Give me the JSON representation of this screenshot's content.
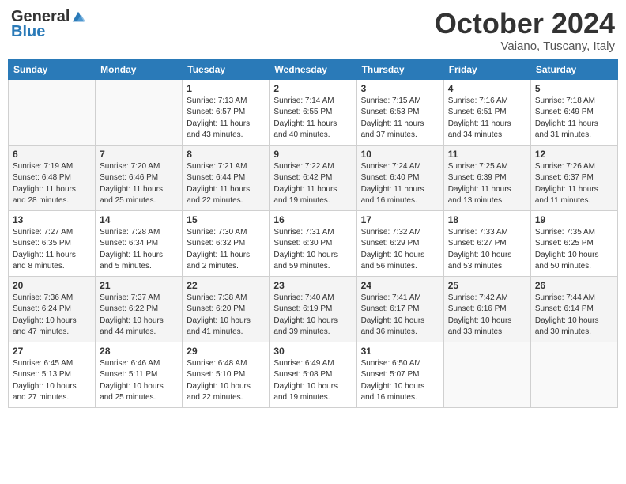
{
  "header": {
    "logo_general": "General",
    "logo_blue": "Blue",
    "month_title": "October 2024",
    "location": "Vaiano, Tuscany, Italy"
  },
  "days_of_week": [
    "Sunday",
    "Monday",
    "Tuesday",
    "Wednesday",
    "Thursday",
    "Friday",
    "Saturday"
  ],
  "weeks": [
    [
      {
        "day": "",
        "sunrise": "",
        "sunset": "",
        "daylight": ""
      },
      {
        "day": "",
        "sunrise": "",
        "sunset": "",
        "daylight": ""
      },
      {
        "day": "1",
        "sunrise": "Sunrise: 7:13 AM",
        "sunset": "Sunset: 6:57 PM",
        "daylight": "Daylight: 11 hours and 43 minutes."
      },
      {
        "day": "2",
        "sunrise": "Sunrise: 7:14 AM",
        "sunset": "Sunset: 6:55 PM",
        "daylight": "Daylight: 11 hours and 40 minutes."
      },
      {
        "day": "3",
        "sunrise": "Sunrise: 7:15 AM",
        "sunset": "Sunset: 6:53 PM",
        "daylight": "Daylight: 11 hours and 37 minutes."
      },
      {
        "day": "4",
        "sunrise": "Sunrise: 7:16 AM",
        "sunset": "Sunset: 6:51 PM",
        "daylight": "Daylight: 11 hours and 34 minutes."
      },
      {
        "day": "5",
        "sunrise": "Sunrise: 7:18 AM",
        "sunset": "Sunset: 6:49 PM",
        "daylight": "Daylight: 11 hours and 31 minutes."
      }
    ],
    [
      {
        "day": "6",
        "sunrise": "Sunrise: 7:19 AM",
        "sunset": "Sunset: 6:48 PM",
        "daylight": "Daylight: 11 hours and 28 minutes."
      },
      {
        "day": "7",
        "sunrise": "Sunrise: 7:20 AM",
        "sunset": "Sunset: 6:46 PM",
        "daylight": "Daylight: 11 hours and 25 minutes."
      },
      {
        "day": "8",
        "sunrise": "Sunrise: 7:21 AM",
        "sunset": "Sunset: 6:44 PM",
        "daylight": "Daylight: 11 hours and 22 minutes."
      },
      {
        "day": "9",
        "sunrise": "Sunrise: 7:22 AM",
        "sunset": "Sunset: 6:42 PM",
        "daylight": "Daylight: 11 hours and 19 minutes."
      },
      {
        "day": "10",
        "sunrise": "Sunrise: 7:24 AM",
        "sunset": "Sunset: 6:40 PM",
        "daylight": "Daylight: 11 hours and 16 minutes."
      },
      {
        "day": "11",
        "sunrise": "Sunrise: 7:25 AM",
        "sunset": "Sunset: 6:39 PM",
        "daylight": "Daylight: 11 hours and 13 minutes."
      },
      {
        "day": "12",
        "sunrise": "Sunrise: 7:26 AM",
        "sunset": "Sunset: 6:37 PM",
        "daylight": "Daylight: 11 hours and 11 minutes."
      }
    ],
    [
      {
        "day": "13",
        "sunrise": "Sunrise: 7:27 AM",
        "sunset": "Sunset: 6:35 PM",
        "daylight": "Daylight: 11 hours and 8 minutes."
      },
      {
        "day": "14",
        "sunrise": "Sunrise: 7:28 AM",
        "sunset": "Sunset: 6:34 PM",
        "daylight": "Daylight: 11 hours and 5 minutes."
      },
      {
        "day": "15",
        "sunrise": "Sunrise: 7:30 AM",
        "sunset": "Sunset: 6:32 PM",
        "daylight": "Daylight: 11 hours and 2 minutes."
      },
      {
        "day": "16",
        "sunrise": "Sunrise: 7:31 AM",
        "sunset": "Sunset: 6:30 PM",
        "daylight": "Daylight: 10 hours and 59 minutes."
      },
      {
        "day": "17",
        "sunrise": "Sunrise: 7:32 AM",
        "sunset": "Sunset: 6:29 PM",
        "daylight": "Daylight: 10 hours and 56 minutes."
      },
      {
        "day": "18",
        "sunrise": "Sunrise: 7:33 AM",
        "sunset": "Sunset: 6:27 PM",
        "daylight": "Daylight: 10 hours and 53 minutes."
      },
      {
        "day": "19",
        "sunrise": "Sunrise: 7:35 AM",
        "sunset": "Sunset: 6:25 PM",
        "daylight": "Daylight: 10 hours and 50 minutes."
      }
    ],
    [
      {
        "day": "20",
        "sunrise": "Sunrise: 7:36 AM",
        "sunset": "Sunset: 6:24 PM",
        "daylight": "Daylight: 10 hours and 47 minutes."
      },
      {
        "day": "21",
        "sunrise": "Sunrise: 7:37 AM",
        "sunset": "Sunset: 6:22 PM",
        "daylight": "Daylight: 10 hours and 44 minutes."
      },
      {
        "day": "22",
        "sunrise": "Sunrise: 7:38 AM",
        "sunset": "Sunset: 6:20 PM",
        "daylight": "Daylight: 10 hours and 41 minutes."
      },
      {
        "day": "23",
        "sunrise": "Sunrise: 7:40 AM",
        "sunset": "Sunset: 6:19 PM",
        "daylight": "Daylight: 10 hours and 39 minutes."
      },
      {
        "day": "24",
        "sunrise": "Sunrise: 7:41 AM",
        "sunset": "Sunset: 6:17 PM",
        "daylight": "Daylight: 10 hours and 36 minutes."
      },
      {
        "day": "25",
        "sunrise": "Sunrise: 7:42 AM",
        "sunset": "Sunset: 6:16 PM",
        "daylight": "Daylight: 10 hours and 33 minutes."
      },
      {
        "day": "26",
        "sunrise": "Sunrise: 7:44 AM",
        "sunset": "Sunset: 6:14 PM",
        "daylight": "Daylight: 10 hours and 30 minutes."
      }
    ],
    [
      {
        "day": "27",
        "sunrise": "Sunrise: 6:45 AM",
        "sunset": "Sunset: 5:13 PM",
        "daylight": "Daylight: 10 hours and 27 minutes."
      },
      {
        "day": "28",
        "sunrise": "Sunrise: 6:46 AM",
        "sunset": "Sunset: 5:11 PM",
        "daylight": "Daylight: 10 hours and 25 minutes."
      },
      {
        "day": "29",
        "sunrise": "Sunrise: 6:48 AM",
        "sunset": "Sunset: 5:10 PM",
        "daylight": "Daylight: 10 hours and 22 minutes."
      },
      {
        "day": "30",
        "sunrise": "Sunrise: 6:49 AM",
        "sunset": "Sunset: 5:08 PM",
        "daylight": "Daylight: 10 hours and 19 minutes."
      },
      {
        "day": "31",
        "sunrise": "Sunrise: 6:50 AM",
        "sunset": "Sunset: 5:07 PM",
        "daylight": "Daylight: 10 hours and 16 minutes."
      },
      {
        "day": "",
        "sunrise": "",
        "sunset": "",
        "daylight": ""
      },
      {
        "day": "",
        "sunrise": "",
        "sunset": "",
        "daylight": ""
      }
    ]
  ]
}
